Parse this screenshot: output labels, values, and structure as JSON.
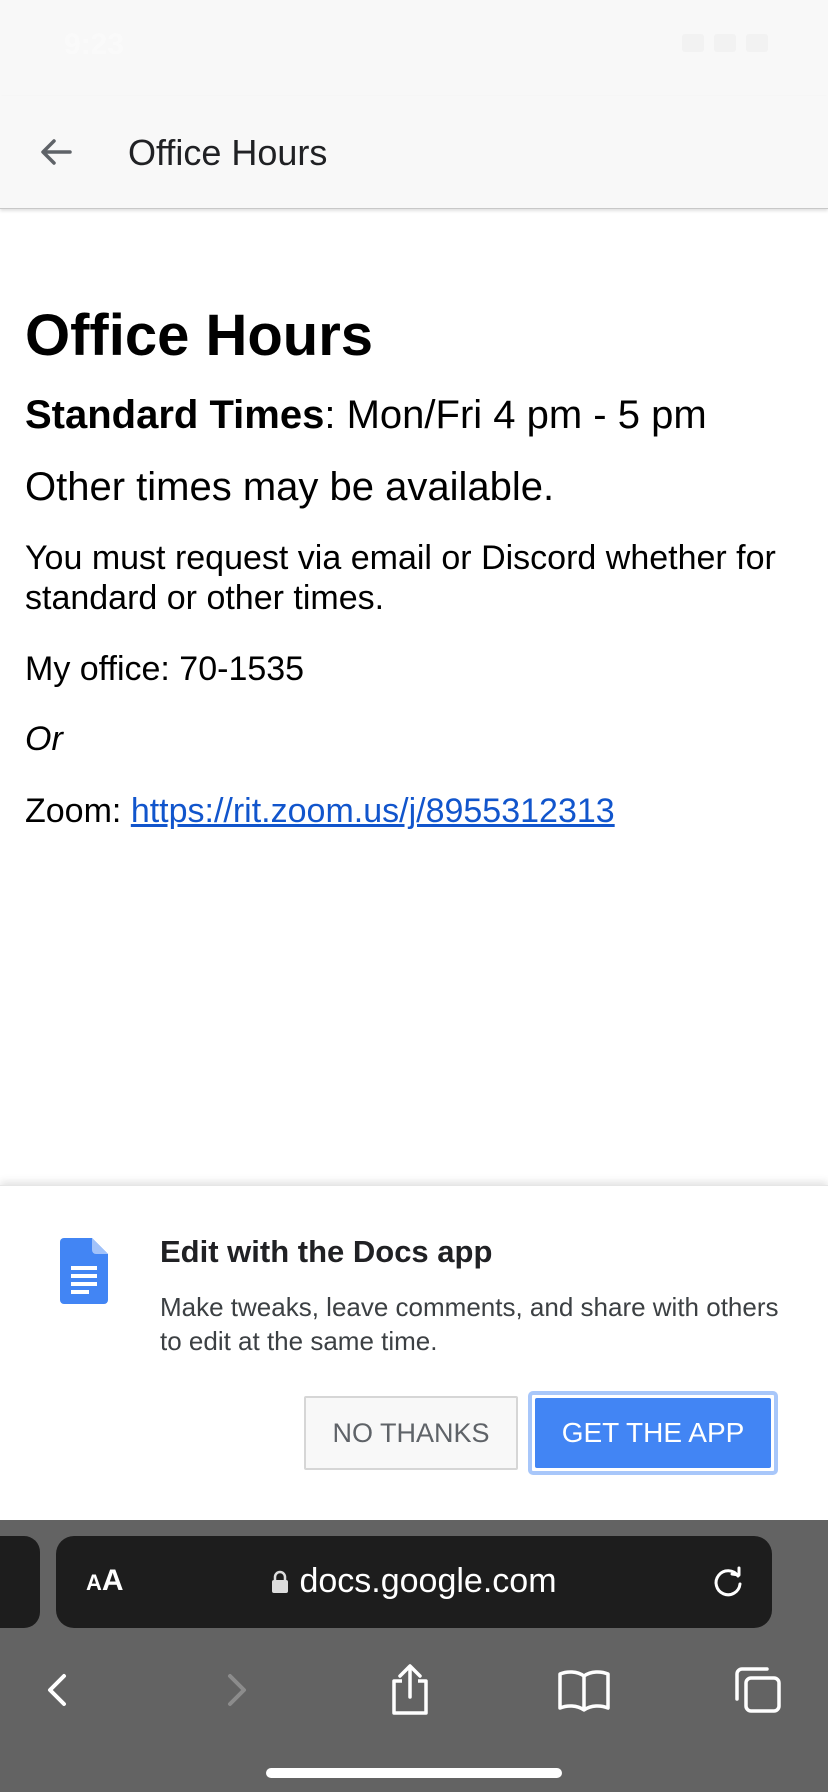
{
  "status_bar": {
    "time": "9:23"
  },
  "header": {
    "title": "Office Hours"
  },
  "document": {
    "title": "Office Hours",
    "standard_label": "Standard Times",
    "standard_value": ": Mon/Fri 4 pm - 5 pm",
    "availability": "Other times may be available.",
    "request_note": "You must request via email or Discord whether for standard or other times.",
    "office": "My office: 70-1535",
    "or": "Or",
    "zoom_label": "Zoom: ",
    "zoom_link": "https://rit.zoom.us/j/8955312313"
  },
  "promo": {
    "title": "Edit with the Docs app",
    "text": "Make tweaks, leave comments, and share with others to edit at the same time.",
    "no_thanks": "NO THANKS",
    "get_app": "GET THE APP",
    "icon": "google-docs-icon",
    "accent": "#4285f4"
  },
  "browser": {
    "text_size_label_small": "A",
    "text_size_label_large": "A",
    "url": "docs.google.com"
  }
}
